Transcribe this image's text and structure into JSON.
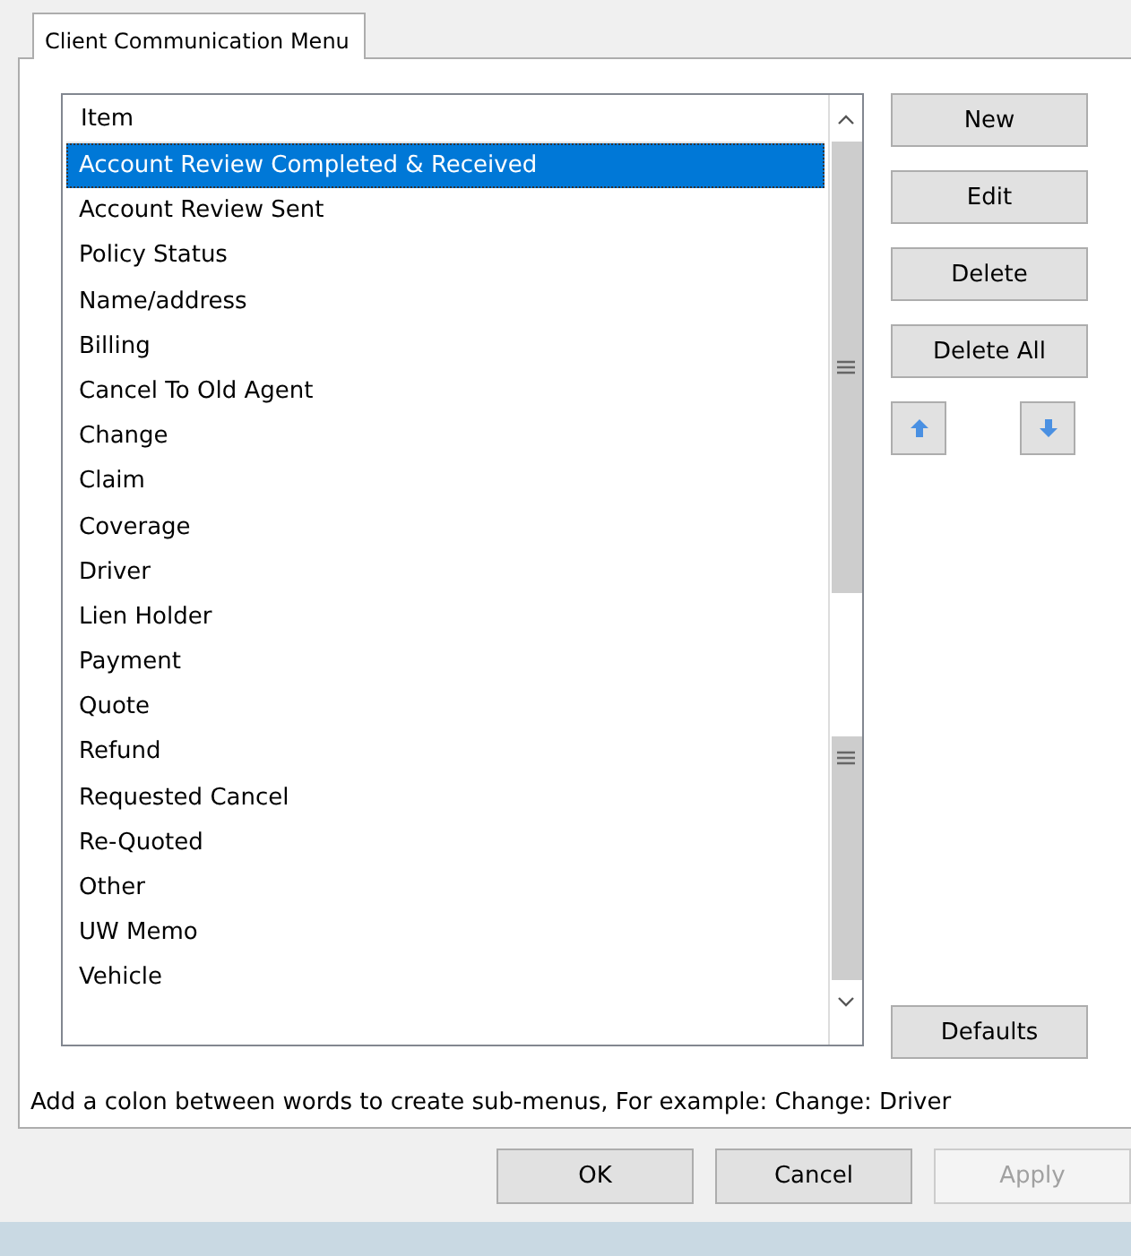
{
  "tabs": [
    {
      "label": "Client Communication Menu",
      "selected": true
    }
  ],
  "list": {
    "header": "Item",
    "items": [
      {
        "label": "Account Review Completed & Received",
        "selected": true
      },
      {
        "label": "Account Review Sent",
        "selected": false
      },
      {
        "label": "Policy Status",
        "selected": false
      },
      {
        "label": "Name/address",
        "selected": false
      },
      {
        "label": "Billing",
        "selected": false
      },
      {
        "label": "Cancel To Old Agent",
        "selected": false
      },
      {
        "label": "Change",
        "selected": false
      },
      {
        "label": "Claim",
        "selected": false
      },
      {
        "label": "Coverage",
        "selected": false
      },
      {
        "label": "Driver",
        "selected": false
      },
      {
        "label": "Lien Holder",
        "selected": false
      },
      {
        "label": "Payment",
        "selected": false
      },
      {
        "label": "Quote",
        "selected": false
      },
      {
        "label": "Refund",
        "selected": false
      },
      {
        "label": "Requested Cancel",
        "selected": false
      },
      {
        "label": "Re-Quoted",
        "selected": false
      },
      {
        "label": "Other",
        "selected": false
      },
      {
        "label": "UW Memo",
        "selected": false
      },
      {
        "label": "Vehicle",
        "selected": false
      }
    ]
  },
  "side_buttons": [
    {
      "label": "New"
    },
    {
      "label": "Edit"
    },
    {
      "label": "Delete"
    },
    {
      "label": "Delete All"
    }
  ],
  "defaults_button": "Defaults",
  "hint": "Add a colon between words to create sub-menus, For example: Change: Driver",
  "dialog_buttons": [
    {
      "label": "OK",
      "disabled": false
    },
    {
      "label": "Cancel",
      "disabled": false
    },
    {
      "label": "Apply",
      "disabled": true
    }
  ]
}
